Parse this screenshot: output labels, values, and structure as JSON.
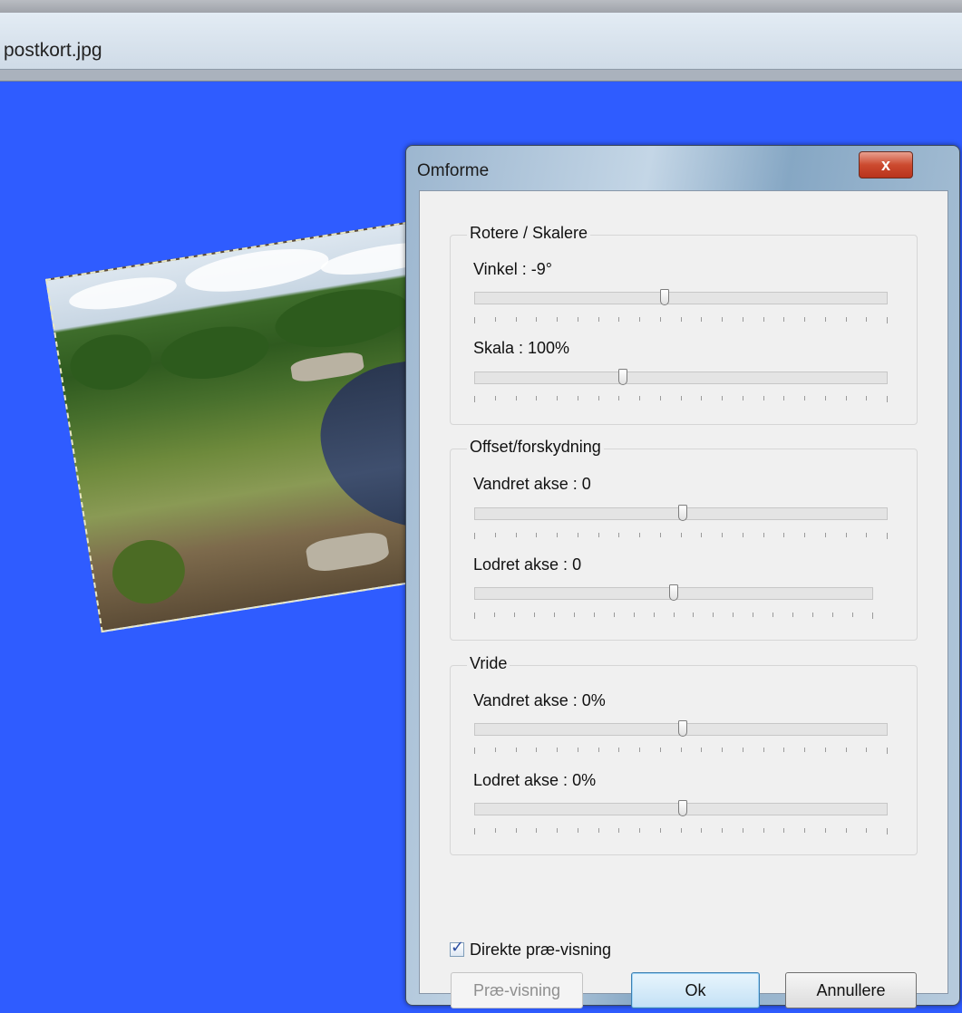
{
  "document": {
    "title": "postkort.jpg"
  },
  "dialog": {
    "title": "Omforme",
    "close_label": "x",
    "groups": [
      {
        "title": "Rotere / Skalere",
        "sliders": [
          {
            "label": "Vinkel : -9°",
            "value_fraction": 0.46
          },
          {
            "label": "Skala : 100%",
            "value_fraction": 0.355
          }
        ]
      },
      {
        "title": "Offset/forskydning",
        "sliders": [
          {
            "label": "Vandret akse : 0",
            "value_fraction": 0.505
          },
          {
            "label": "Lodret akse : 0",
            "value_fraction": 0.5
          }
        ]
      },
      {
        "title": "Vride",
        "sliders": [
          {
            "label": "Vandret akse : 0%",
            "value_fraction": 0.505
          },
          {
            "label": "Lodret akse : 0%",
            "value_fraction": 0.505
          }
        ]
      }
    ],
    "checkbox": {
      "label": "Direkte præ-visning",
      "checked": true
    },
    "buttons": {
      "preview": "Præ-visning",
      "ok": "Ok",
      "cancel": "Annullere"
    }
  }
}
